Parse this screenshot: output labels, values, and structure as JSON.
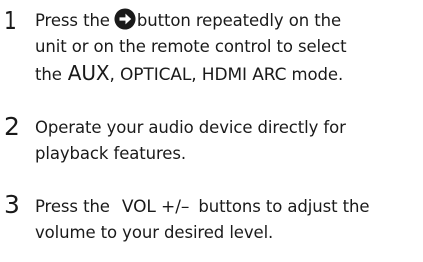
{
  "steps": [
    {
      "number": "1",
      "press_the": "Press the",
      "after_icon": "button repeatedly on the",
      "line2": "unit or on the remote control to select",
      "the": "the",
      "mode_aux": "AUX",
      "sep1": ",",
      "mode_optical": "OPTICAL",
      "sep2": ",",
      "mode_hdmi": "HDMI ARC",
      "mode_suffix": "mode.",
      "icon": "source-arrow-icon"
    },
    {
      "number": "2",
      "line1": "Operate your audio device directly for",
      "line2": "playback features."
    },
    {
      "number": "3",
      "press_the": "Press the",
      "vol_label": "VOL +/–",
      "after_vol": "buttons to adjust the",
      "line2": "volume to your desired level."
    }
  ]
}
